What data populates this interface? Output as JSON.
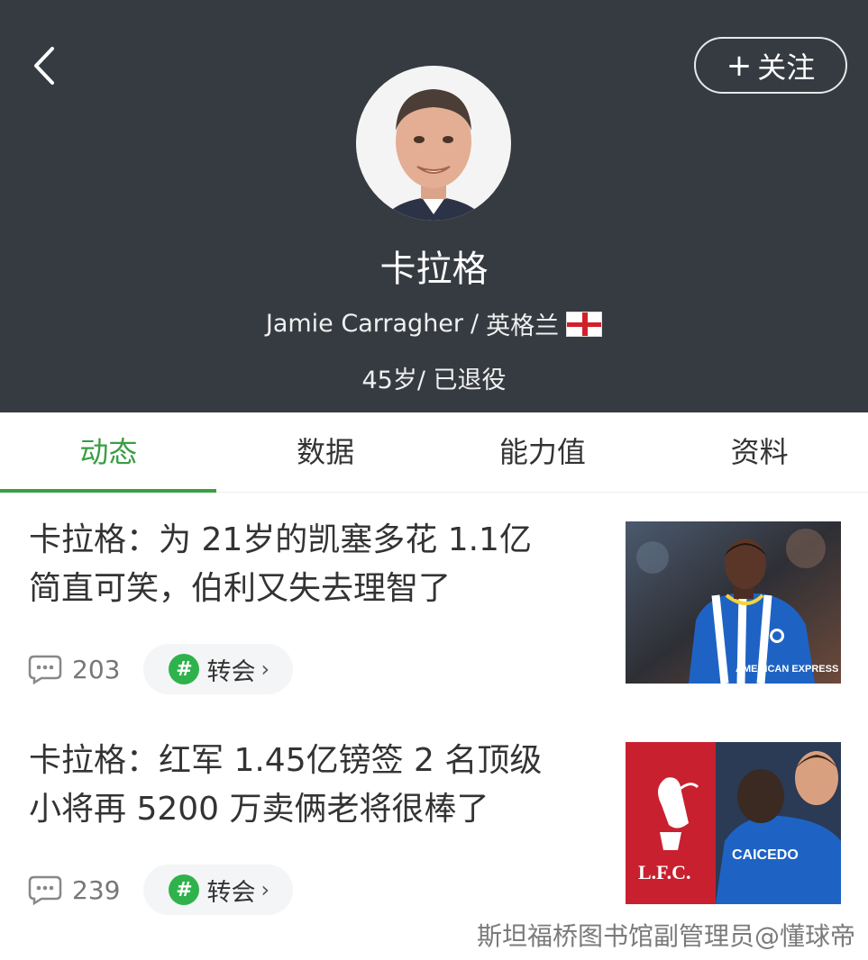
{
  "header": {
    "follow_plus": "+",
    "follow_label": "关注",
    "name": "卡拉格",
    "english_name": "Jamie Carragher",
    "separator": "/",
    "nationality": "英格兰",
    "age_status": "45岁/ 已退役"
  },
  "tabs": [
    {
      "label": "动态",
      "active": true
    },
    {
      "label": "数据",
      "active": false
    },
    {
      "label": "能力值",
      "active": false
    },
    {
      "label": "资料",
      "active": false
    }
  ],
  "articles": [
    {
      "title_line1": "卡拉格：为 21岁的凯塞多花 1.1亿",
      "title_line2": "简直可笑，伯利又失去理智了",
      "comments": "203",
      "tag": "转会",
      "tag_icon": "#",
      "chevron": "›",
      "image_text": "AMERICAN EXPRESS"
    },
    {
      "title_line1": "卡拉格：红军 1.45亿镑签 2 名顶级",
      "title_line2": "小将再 5200 万卖俩老将很棒了",
      "comments": "239",
      "tag": "转会",
      "tag_icon": "#",
      "chevron": "›",
      "image_text_left": "L.F.C.",
      "image_text_right": "CAICEDO"
    }
  ],
  "watermark": "斯坦福桥图书馆副管理员@懂球帝",
  "colors": {
    "header_bg": "#363b42",
    "accent": "#3a9e44",
    "tag_icon": "#2fb24b"
  }
}
